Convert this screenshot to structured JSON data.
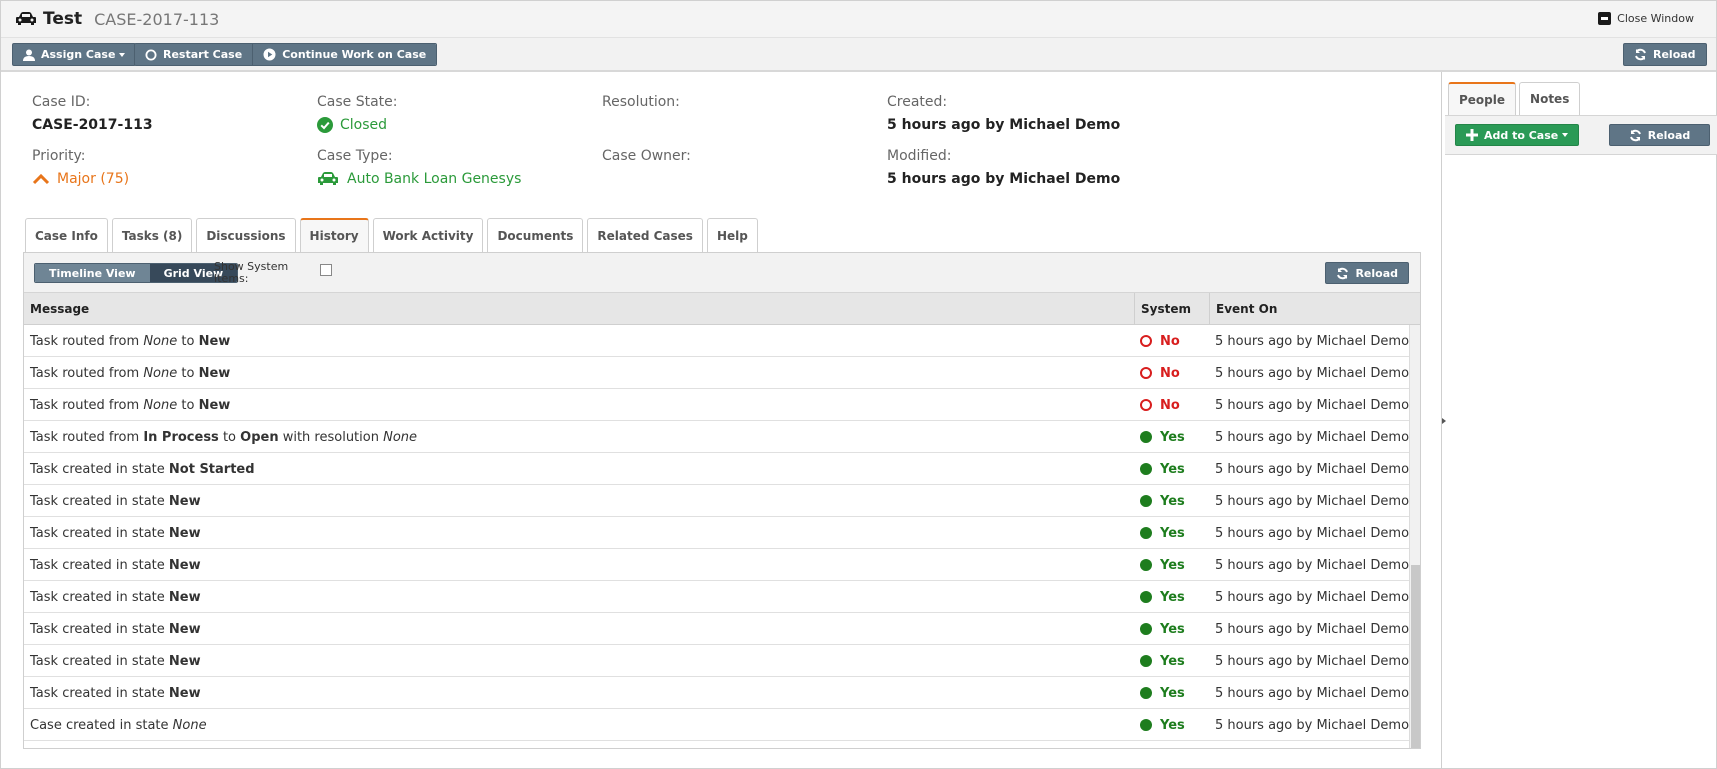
{
  "titlebar": {
    "app_title": "Test",
    "case_id": "CASE-2017-113",
    "close_label": "Close Window"
  },
  "toolbar": {
    "assign_label": "Assign Case",
    "restart_label": "Restart Case",
    "continue_label": "Continue Work on Case",
    "reload_label": "Reload"
  },
  "details": {
    "case_id_label": "Case ID:",
    "case_id_value": "CASE-2017-113",
    "state_label": "Case State:",
    "state_value": "Closed",
    "resolution_label": "Resolution:",
    "resolution_value": "",
    "created_label": "Created:",
    "created_value": "5 hours ago by Michael Demo",
    "priority_label": "Priority:",
    "priority_value": "Major (75)",
    "type_label": "Case Type:",
    "type_value": "Auto Bank Loan Genesys",
    "owner_label": "Case Owner:",
    "owner_value": "",
    "modified_label": "Modified:",
    "modified_value": "5 hours ago by Michael Demo"
  },
  "tabs": [
    "Case Info",
    "Tasks (8)",
    "Discussions",
    "History",
    "Work Activity",
    "Documents",
    "Related Cases",
    "Help"
  ],
  "history": {
    "timeline_label": "Timeline View",
    "grid_label": "Grid View",
    "show_system_label": "Show System Items:",
    "reload_label": "Reload",
    "columns": [
      "Message",
      "System",
      "Event On"
    ],
    "rows": [
      {
        "msg": [
          [
            "Task routed from ",
            ""
          ],
          [
            "None",
            "i"
          ],
          [
            " to ",
            ""
          ],
          [
            "New",
            "b"
          ]
        ],
        "system": "No",
        "event": "5 hours ago by Michael Demo"
      },
      {
        "msg": [
          [
            "Task routed from ",
            ""
          ],
          [
            "None",
            "i"
          ],
          [
            " to ",
            ""
          ],
          [
            "New",
            "b"
          ]
        ],
        "system": "No",
        "event": "5 hours ago by Michael Demo"
      },
      {
        "msg": [
          [
            "Task routed from ",
            ""
          ],
          [
            "None",
            "i"
          ],
          [
            " to ",
            ""
          ],
          [
            "New",
            "b"
          ]
        ],
        "system": "No",
        "event": "5 hours ago by Michael Demo"
      },
      {
        "msg": [
          [
            "Task routed from ",
            ""
          ],
          [
            "In Process",
            "b"
          ],
          [
            " to ",
            ""
          ],
          [
            "Open",
            "b"
          ],
          [
            " with resolution ",
            ""
          ],
          [
            "None",
            "i"
          ]
        ],
        "system": "Yes",
        "event": "5 hours ago by Michael Demo"
      },
      {
        "msg": [
          [
            "Task created in state ",
            ""
          ],
          [
            "Not Started",
            "b"
          ]
        ],
        "system": "Yes",
        "event": "5 hours ago by Michael Demo"
      },
      {
        "msg": [
          [
            "Task created in state ",
            ""
          ],
          [
            "New",
            "b"
          ]
        ],
        "system": "Yes",
        "event": "5 hours ago by Michael Demo"
      },
      {
        "msg": [
          [
            "Task created in state ",
            ""
          ],
          [
            "New",
            "b"
          ]
        ],
        "system": "Yes",
        "event": "5 hours ago by Michael Demo"
      },
      {
        "msg": [
          [
            "Task created in state ",
            ""
          ],
          [
            "New",
            "b"
          ]
        ],
        "system": "Yes",
        "event": "5 hours ago by Michael Demo"
      },
      {
        "msg": [
          [
            "Task created in state ",
            ""
          ],
          [
            "New",
            "b"
          ]
        ],
        "system": "Yes",
        "event": "5 hours ago by Michael Demo"
      },
      {
        "msg": [
          [
            "Task created in state ",
            ""
          ],
          [
            "New",
            "b"
          ]
        ],
        "system": "Yes",
        "event": "5 hours ago by Michael Demo"
      },
      {
        "msg": [
          [
            "Task created in state ",
            ""
          ],
          [
            "New",
            "b"
          ]
        ],
        "system": "Yes",
        "event": "5 hours ago by Michael Demo"
      },
      {
        "msg": [
          [
            "Task created in state ",
            ""
          ],
          [
            "New",
            "b"
          ]
        ],
        "system": "Yes",
        "event": "5 hours ago by Michael Demo"
      },
      {
        "msg": [
          [
            "Case created in state ",
            ""
          ],
          [
            "None",
            "i"
          ]
        ],
        "system": "Yes",
        "event": "5 hours ago by Michael Demo"
      }
    ]
  },
  "side": {
    "tabs": [
      "People",
      "Notes"
    ],
    "add_label": "Add to Case",
    "reload_label": "Reload"
  },
  "colors": {
    "accent": "#e8751a",
    "button": "#5f7586",
    "green": "#2a9a56",
    "yes": "#1e7d1e",
    "no": "#d81e1e"
  }
}
